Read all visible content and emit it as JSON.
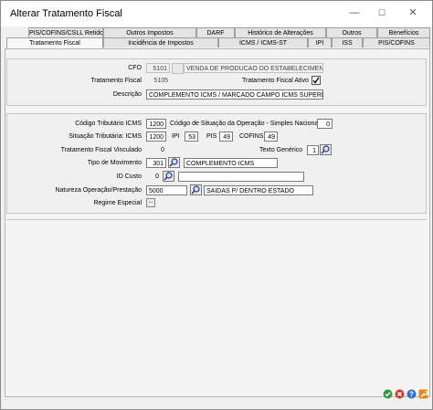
{
  "window": {
    "title": "Alterar Tratamento Fiscal",
    "minimize": "—",
    "maximize": "☐",
    "close": "✕"
  },
  "tabs_top": [
    "PIS/COFINS/CSLL Retido",
    "Outros Impostos",
    "DARF",
    "Histórico de Alterações",
    "Outros",
    "Benefícios"
  ],
  "tabs_bottom": [
    "Tratamento Fiscal",
    "Incidência de Impostos",
    "ICMS / ICMS-ST",
    "IPI",
    "ISS",
    "PIS/COFINS"
  ],
  "form": {
    "cfo_label": "CFO",
    "cfo_code": "5101",
    "cfo_desc": "VENDA DE PRODUCAO DO ESTABELECIMENTO",
    "tf_label": "Tratamento Fiscal",
    "tf_value": "5105",
    "ativo_label": "Tratamento Fiscal Ativo",
    "ativo_checked": true,
    "descricao_label": "Descrição",
    "descricao_value": "COMPLEMENTO ICMS / MARCADO CAMPO ICMS SUPERIOR",
    "cod_trib_icms_label": "Código Tributário ICMS",
    "cod_trib_icms_value": "1200",
    "cod_sit_op_label": "Código de Situação da Operação - Simples Nacional",
    "cod_sit_op_value": "0",
    "sit_trib_icms_label": "Situação Tributária: ICMS",
    "sit_trib_icms_value": "1200",
    "ipi_label": "IPI",
    "ipi_value": "53",
    "pis_label": "PIS",
    "pis_value": "49",
    "cofins_label": "COFINS",
    "cofins_value": "49",
    "tf_vinculado_label": "Tratamento Fiscal Vinculado",
    "tf_vinculado_value": "0",
    "texto_generico_label": "Texto Genérico",
    "texto_generico_value": "1",
    "tipo_mov_label": "Tipo de Movimento",
    "tipo_mov_code": "301",
    "tipo_mov_desc": "COMPLEMENTO ICMS",
    "id_custo_label": "ID Custo",
    "id_custo_value": "0",
    "id_custo_desc": "",
    "natureza_label": "Natureza Operação/Prestação",
    "natureza_code": "5000",
    "natureza_desc": "SAIDAS P/ DENTRO ESTADO",
    "regime_label": "Regime Especial",
    "regime_btn": "..."
  },
  "footer": {
    "ok_color": "#2e9e3e",
    "cancel_color": "#d23a2a",
    "help_color": "#2f6fcf",
    "tools_color": "#e08a1e"
  }
}
